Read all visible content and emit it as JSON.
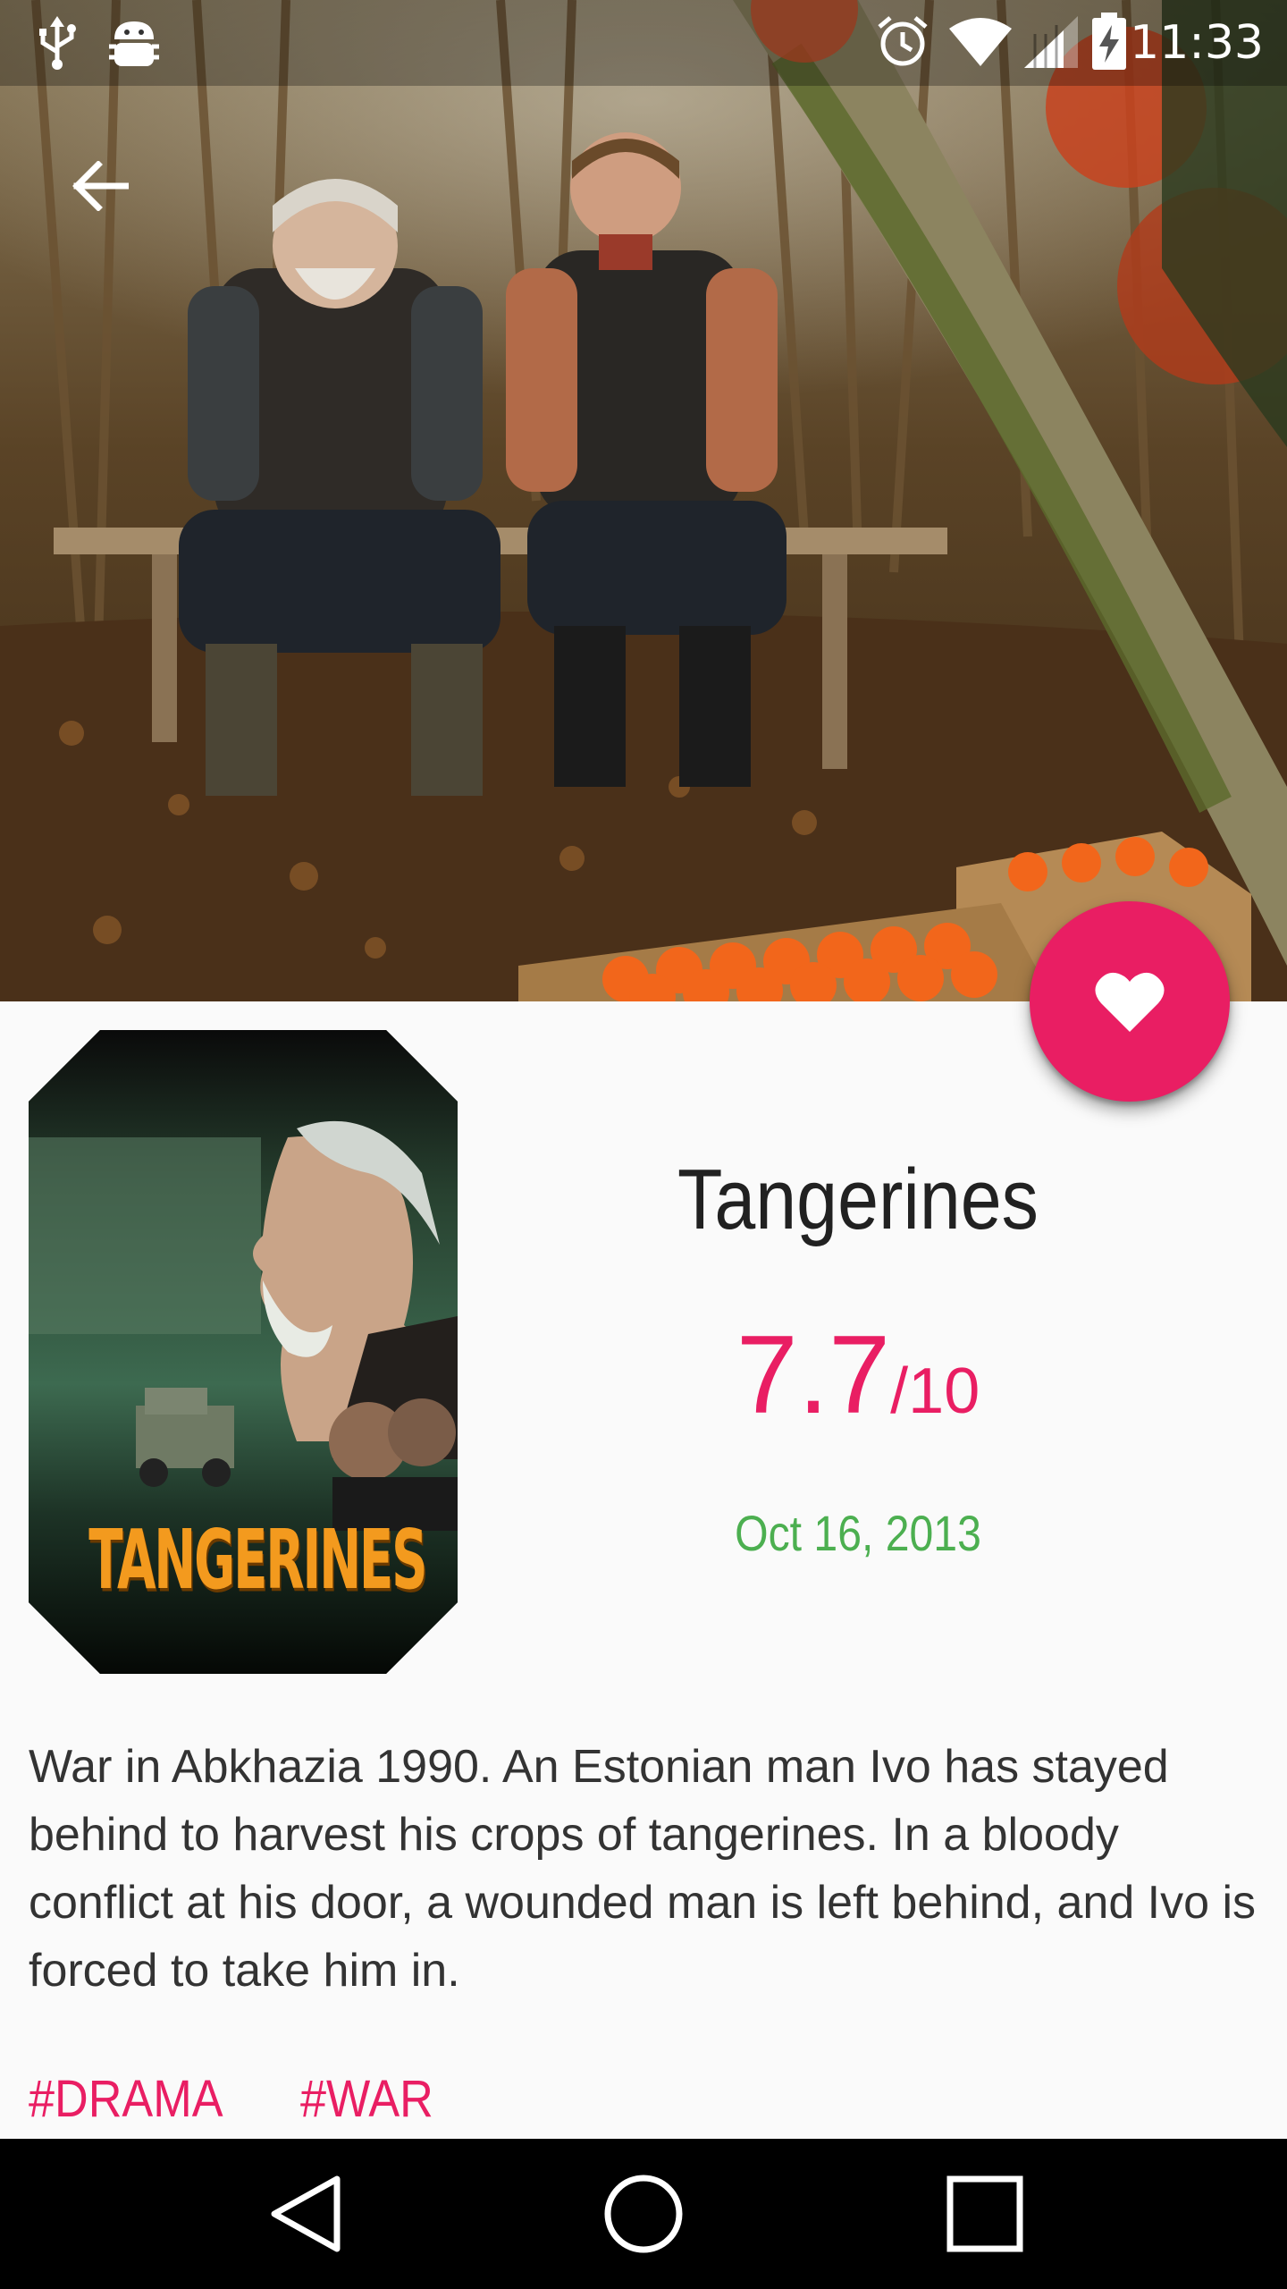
{
  "status_bar": {
    "time": "11:33",
    "icons": [
      "usb-icon",
      "android-debug-icon",
      "alarm-icon",
      "wifi-icon",
      "signal-icon",
      "battery-charging-icon"
    ]
  },
  "toolbar": {
    "back_icon": "arrow-back-icon"
  },
  "fab": {
    "icon": "heart-icon",
    "color": "#e91e63"
  },
  "movie": {
    "title": "Tangerines",
    "rating": "7.7",
    "rating_max": "/10",
    "release_date": "Oct 16, 2013",
    "overview": "War in Abkhazia 1990. An Estonian man Ivo has stayed behind to harvest his crops of tangerines. In a bloody conflict at his door, a wounded man is left behind, and Ivo is forced to take him in.",
    "genres": [
      "#DRAMA",
      "#WAR"
    ],
    "poster_text": "TANGERINES"
  },
  "colors": {
    "accent": "#e91e63",
    "date": "#4caf50",
    "text_primary": "#212121",
    "background": "#fafafa"
  },
  "nav_bar": {
    "buttons": [
      "back-triangle-icon",
      "home-circle-icon",
      "recents-square-icon"
    ]
  }
}
